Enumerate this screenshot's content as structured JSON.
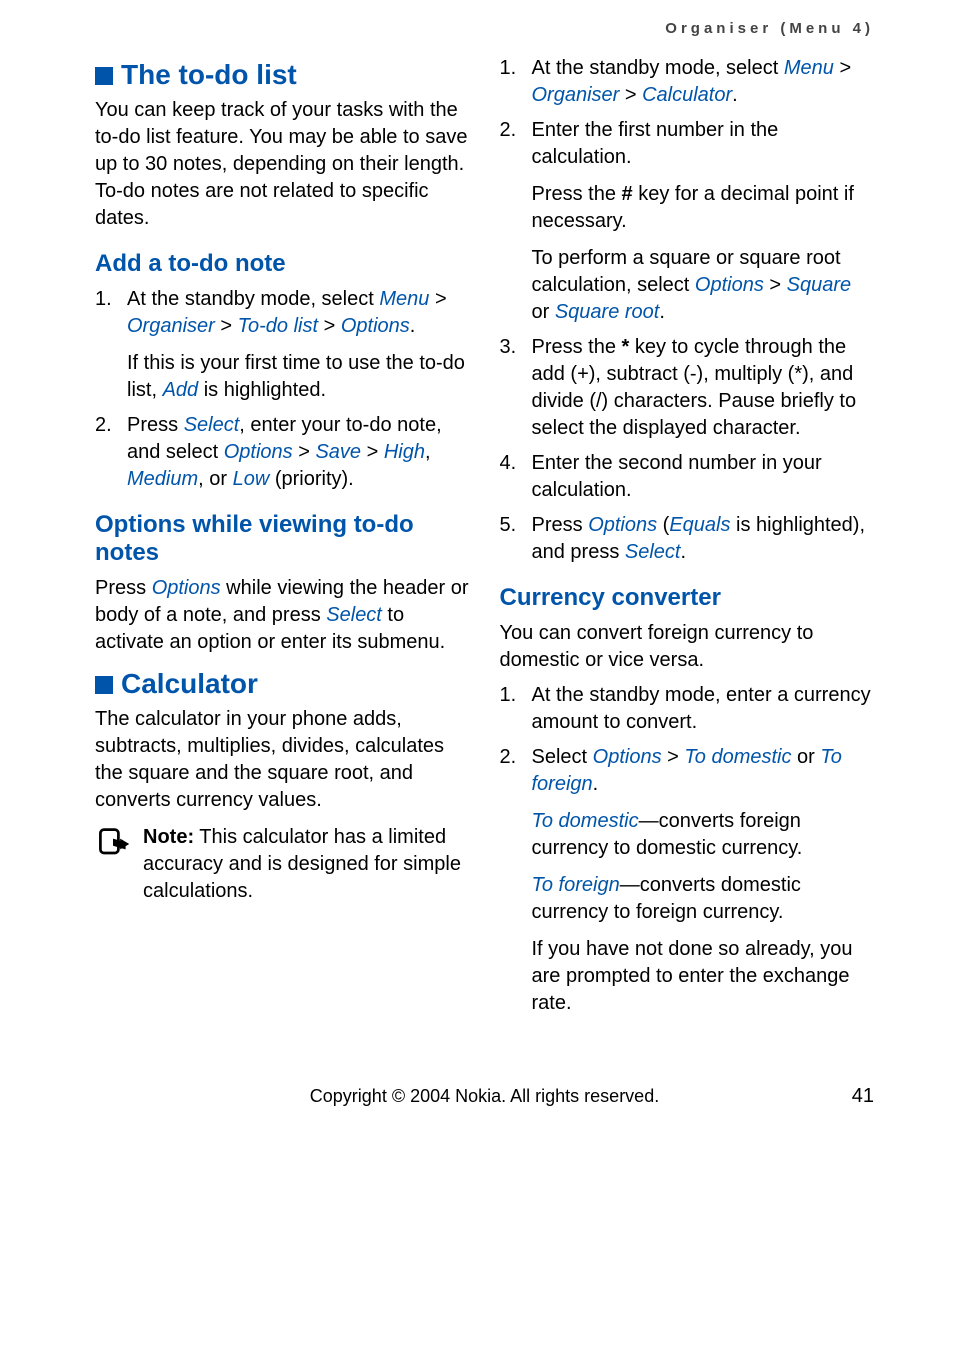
{
  "header": "Organiser (Menu 4)",
  "left": {
    "todo_title": "The to-do list",
    "todo_intro": "You can keep track of your tasks with the to-do list feature. You may be able to save up to 30 notes, depending on their length. To-do notes are not related to specific dates.",
    "add_title": "Add a to-do note",
    "add_step1_a": "At the standby mode, select ",
    "add_step1_path": [
      {
        "t": "Menu",
        "em": true
      },
      {
        "t": " > ",
        "em": false
      },
      {
        "t": "Organiser",
        "em": true
      },
      {
        "t": " > ",
        "em": false
      },
      {
        "t": "To-do list",
        "em": true
      },
      {
        "t": " > ",
        "em": false
      },
      {
        "t": "Options",
        "em": true
      },
      {
        "t": ".",
        "em": false
      }
    ],
    "add_step1_b1": "If this is your first time to use the to-do list, ",
    "add_step1_b2": "Add",
    "add_step1_b3": " is highlighted.",
    "add_step2_parts": [
      {
        "t": "Press ",
        "em": false
      },
      {
        "t": "Select",
        "em": true
      },
      {
        "t": ", enter your to-do note, and select ",
        "em": false
      },
      {
        "t": "Options",
        "em": true
      },
      {
        "t": " > ",
        "em": false
      },
      {
        "t": "Save",
        "em": true
      },
      {
        "t": " > ",
        "em": false
      },
      {
        "t": "High",
        "em": true
      },
      {
        "t": ", ",
        "em": false
      },
      {
        "t": "Medium",
        "em": true
      },
      {
        "t": ", or ",
        "em": false
      },
      {
        "t": "Low",
        "em": true
      },
      {
        "t": " (priority).",
        "em": false
      }
    ],
    "opt_title": "Options while viewing to-do notes",
    "opt_para_parts": [
      {
        "t": "Press ",
        "em": false
      },
      {
        "t": "Options",
        "em": true
      },
      {
        "t": " while viewing the header or body of a note, and press ",
        "em": false
      },
      {
        "t": "Select",
        "em": true
      },
      {
        "t": " to activate an option or enter its submenu.",
        "em": false
      }
    ],
    "calc_title": "Calculator",
    "calc_intro": "The calculator in your phone adds, subtracts, multiplies, divides, calculates the square and the square root, and converts currency values.",
    "note_label": "Note:",
    "note_text": " This calculator has a limited accuracy and is designed for simple calculations."
  },
  "right": {
    "calc_step1_a": "At the standby mode, select ",
    "calc_step1_path": [
      {
        "t": "Menu",
        "em": true
      },
      {
        "t": " > ",
        "em": false
      },
      {
        "t": "Organiser",
        "em": true
      },
      {
        "t": " > ",
        "em": false
      },
      {
        "t": "Calculator",
        "em": true
      },
      {
        "t": ".",
        "em": false
      }
    ],
    "calc_step2_a": "Enter the first number in the calculation.",
    "calc_step2_b_parts": [
      {
        "t": "Press the ",
        "em": false
      },
      {
        "t": "#",
        "b": true
      },
      {
        "t": " key for a decimal point if necessary.",
        "em": false
      }
    ],
    "calc_step2_c_parts": [
      {
        "t": "To perform a square or square root calculation, select ",
        "em": false
      },
      {
        "t": "Options",
        "em": true
      },
      {
        "t": " > ",
        "em": false
      },
      {
        "t": "Square",
        "em": true
      },
      {
        "t": " or ",
        "em": false
      },
      {
        "t": "Square root",
        "em": true
      },
      {
        "t": ".",
        "em": false
      }
    ],
    "calc_step3_parts": [
      {
        "t": "Press the ",
        "em": false
      },
      {
        "t": "*",
        "b": true
      },
      {
        "t": " key to cycle through the add (+), subtract (-), multiply (*), and divide (/) characters. Pause briefly to select the displayed character.",
        "em": false
      }
    ],
    "calc_step4": "Enter the second number in your calculation.",
    "calc_step5_parts": [
      {
        "t": "Press ",
        "em": false
      },
      {
        "t": "Options",
        "em": true
      },
      {
        "t": " (",
        "em": false
      },
      {
        "t": "Equals",
        "em": true
      },
      {
        "t": " is highlighted), and press ",
        "em": false
      },
      {
        "t": "Select",
        "em": true
      },
      {
        "t": ".",
        "em": false
      }
    ],
    "cc_title": "Currency converter",
    "cc_intro": "You can convert foreign currency to domestic or vice versa.",
    "cc_step1": "At the standby mode, enter a currency amount to convert.",
    "cc_step2_parts": [
      {
        "t": "Select ",
        "em": false
      },
      {
        "t": "Options",
        "em": true
      },
      {
        "t": " > ",
        "em": false
      },
      {
        "t": "To domestic",
        "em": true
      },
      {
        "t": " or ",
        "em": false
      },
      {
        "t": "To foreign",
        "em": true
      },
      {
        "t": ".",
        "em": false
      }
    ],
    "cc_step2_b_parts": [
      {
        "t": "To domestic",
        "em": true
      },
      {
        "t": "—converts foreign currency to domestic currency.",
        "em": false
      }
    ],
    "cc_step2_c_parts": [
      {
        "t": "To foreign",
        "em": true
      },
      {
        "t": "—converts domestic currency to foreign currency.",
        "em": false
      }
    ],
    "cc_step2_d": "If you have not done so already, you are prompted to enter the exchange rate."
  },
  "footer": {
    "copyright": "Copyright © 2004 Nokia. All rights reserved.",
    "page": "41"
  }
}
